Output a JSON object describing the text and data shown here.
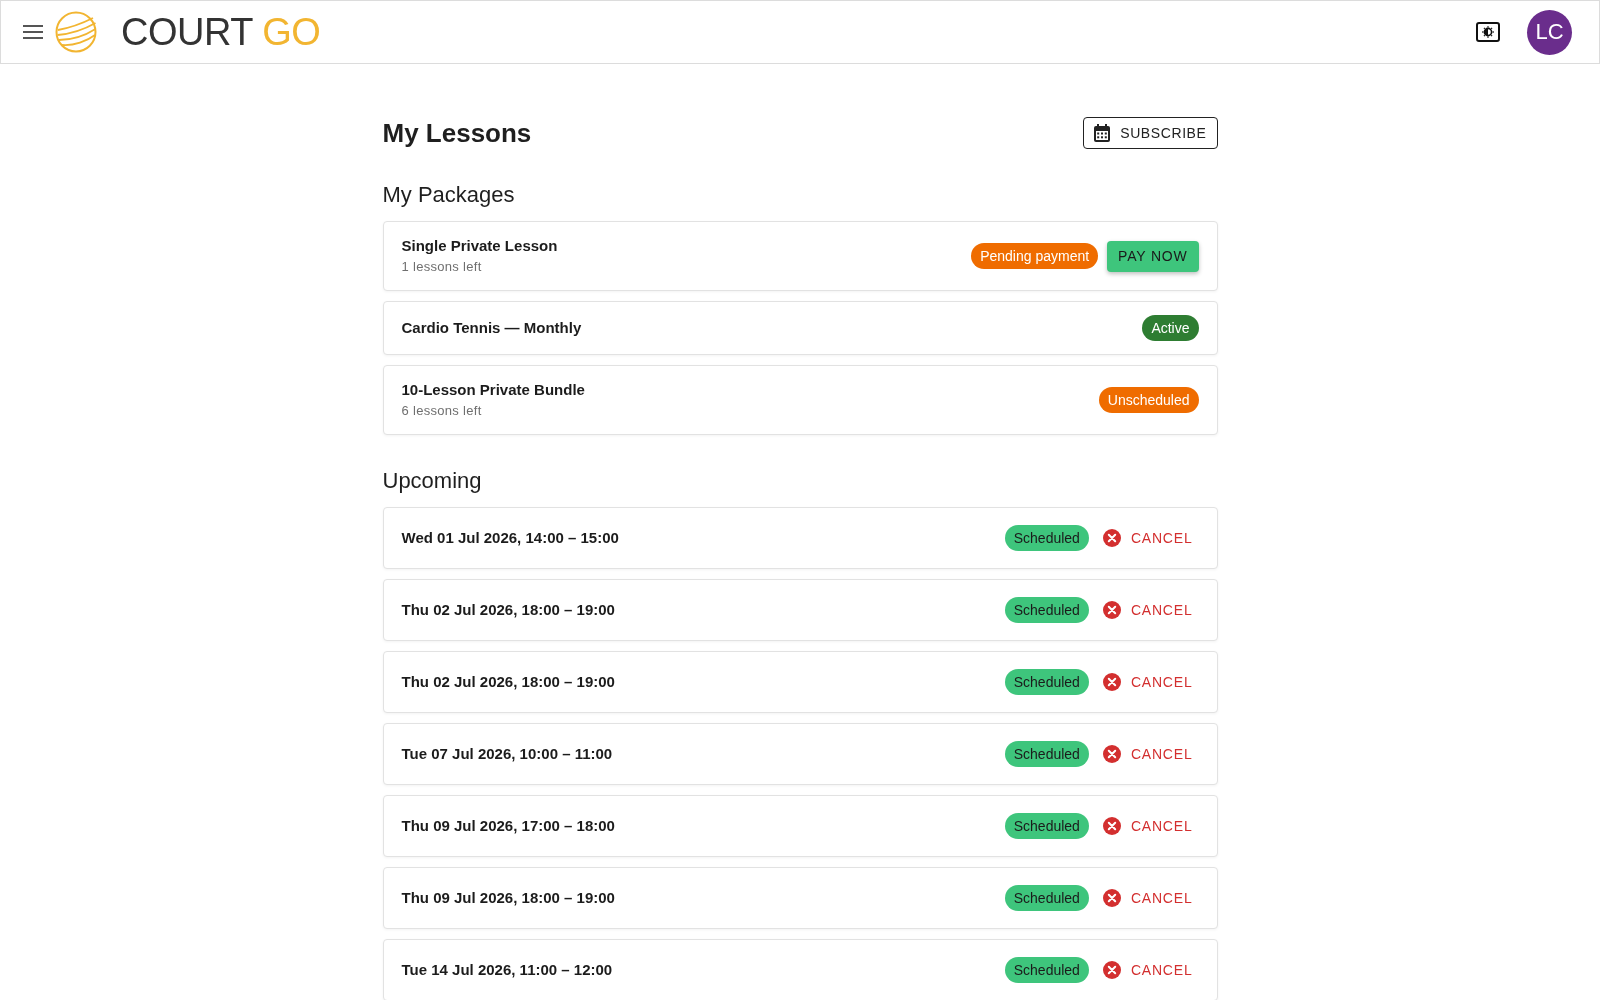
{
  "header": {
    "brand": {
      "name": "COURT",
      "accent": "GO"
    },
    "avatar": {
      "initials": "LC"
    }
  },
  "page": {
    "title": "My Lessons",
    "subscribe_button": "SUBSCRIBE"
  },
  "packages": {
    "heading": "My Packages",
    "items": [
      {
        "name": "Single Private Lesson",
        "detail": "1 lessons left",
        "status": {
          "label": "Pending payment",
          "color": "#ef6c00"
        },
        "action": "PAY NOW"
      },
      {
        "name": "Cardio Tennis — Monthly",
        "status": {
          "label": "Active",
          "color": "#2e7d32"
        }
      },
      {
        "name": "10-Lesson Private Bundle",
        "detail": "6 lessons left",
        "status": {
          "label": "Unscheduled",
          "color": "#ef6c00"
        }
      }
    ]
  },
  "upcoming": {
    "heading": "Upcoming",
    "items": [
      {
        "when": "Wed 01 Jul 2026, 14:00 – 15:00",
        "status": {
          "label": "Scheduled",
          "color": "#3ec57c"
        },
        "action": "CANCEL"
      },
      {
        "when": "Thu 02 Jul 2026, 18:00 – 19:00",
        "status": {
          "label": "Scheduled",
          "color": "#3ec57c"
        },
        "action": "CANCEL"
      },
      {
        "when": "Thu 02 Jul 2026, 18:00 – 19:00",
        "status": {
          "label": "Scheduled",
          "color": "#3ec57c"
        },
        "action": "CANCEL"
      },
      {
        "when": "Tue 07 Jul 2026, 10:00 – 11:00",
        "status": {
          "label": "Scheduled",
          "color": "#3ec57c"
        },
        "action": "CANCEL"
      },
      {
        "when": "Thu 09 Jul 2026, 17:00 – 18:00",
        "status": {
          "label": "Scheduled",
          "color": "#3ec57c"
        },
        "action": "CANCEL"
      },
      {
        "when": "Thu 09 Jul 2026, 18:00 – 19:00",
        "status": {
          "label": "Scheduled",
          "color": "#3ec57c"
        },
        "action": "CANCEL"
      },
      {
        "when": "Tue 14 Jul 2026, 11:00 – 12:00",
        "status": {
          "label": "Scheduled",
          "color": "#3ec57c"
        },
        "action": "CANCEL"
      }
    ]
  }
}
